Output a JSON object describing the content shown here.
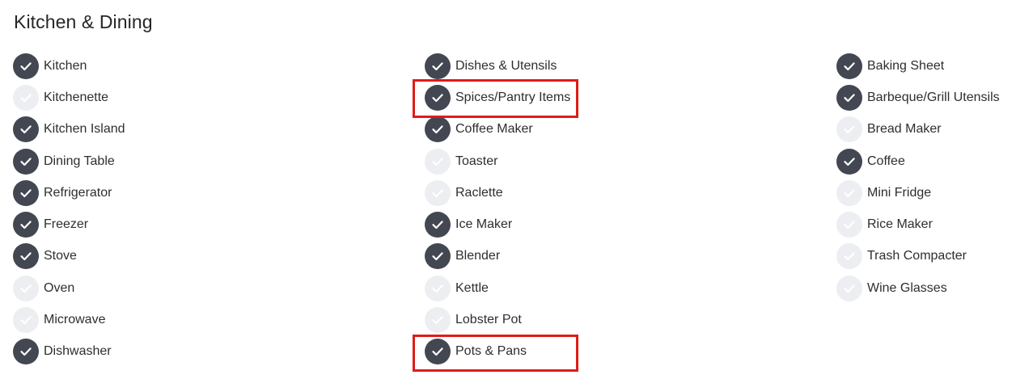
{
  "section": {
    "title": "Kitchen & Dining"
  },
  "columns": [
    {
      "items": [
        {
          "label": "Kitchen",
          "checked": true
        },
        {
          "label": "Kitchenette",
          "checked": false
        },
        {
          "label": "Kitchen Island",
          "checked": true
        },
        {
          "label": "Dining Table",
          "checked": true
        },
        {
          "label": "Refrigerator",
          "checked": true
        },
        {
          "label": "Freezer",
          "checked": true
        },
        {
          "label": "Stove",
          "checked": true
        },
        {
          "label": "Oven",
          "checked": false
        },
        {
          "label": "Microwave",
          "checked": false
        },
        {
          "label": "Dishwasher",
          "checked": true
        }
      ]
    },
    {
      "items": [
        {
          "label": "Dishes & Utensils",
          "checked": true
        },
        {
          "label": "Spices/Pantry Items",
          "checked": true,
          "highlighted": true
        },
        {
          "label": "Coffee Maker",
          "checked": true
        },
        {
          "label": "Toaster",
          "checked": false
        },
        {
          "label": "Raclette",
          "checked": false
        },
        {
          "label": "Ice Maker",
          "checked": true
        },
        {
          "label": "Blender",
          "checked": true
        },
        {
          "label": "Kettle",
          "checked": false
        },
        {
          "label": "Lobster Pot",
          "checked": false
        },
        {
          "label": "Pots & Pans",
          "checked": true,
          "highlighted": true
        }
      ]
    },
    {
      "items": [
        {
          "label": "Baking Sheet",
          "checked": true
        },
        {
          "label": "Barbeque/Grill Utensils",
          "checked": true
        },
        {
          "label": "Bread Maker",
          "checked": false
        },
        {
          "label": "Coffee",
          "checked": true
        },
        {
          "label": "Mini Fridge",
          "checked": false
        },
        {
          "label": "Rice Maker",
          "checked": false
        },
        {
          "label": "Trash Compacter",
          "checked": false
        },
        {
          "label": "Wine Glasses",
          "checked": false
        }
      ]
    }
  ],
  "colors": {
    "checked": "#424752",
    "unchecked": "#eceef1",
    "highlight": "#e01b1b"
  },
  "icons": {
    "checked": "checkmark-circle-icon",
    "unchecked": "checkmark-circle-icon"
  }
}
